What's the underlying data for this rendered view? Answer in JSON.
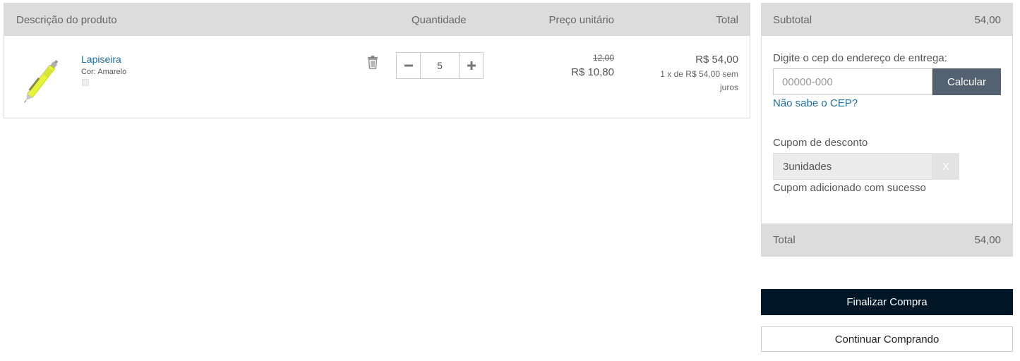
{
  "cart": {
    "headers": {
      "description": "Descrição do produto",
      "quantity": "Quantidade",
      "unit_price": "Preço unitário",
      "total": "Total"
    },
    "item": {
      "name": "Lapiseira",
      "variant": "Cor: Amarelo",
      "quantity": "5",
      "old_unit_price": "12,00",
      "unit_price": "R$ 10,80",
      "line_total": "R$ 54,00",
      "installments": "1 x de R$ 54,00 sem juros",
      "image_icon": "pencil-icon",
      "remove_icon": "trash-icon",
      "minus_icon": "minus-icon",
      "plus_icon": "plus-icon"
    }
  },
  "summary": {
    "subtotal_label": "Subtotal",
    "subtotal_value": "54,00",
    "cep_label": "Digite o cep do endereço de entrega:",
    "cep_placeholder": "00000-000",
    "cep_button": "Calcular",
    "cep_link": "Não sabe o CEP?",
    "coupon_label": "Cupom de desconto",
    "coupon_value": "3unidades",
    "coupon_clear": "X",
    "coupon_message": "Cupom adicionado com sucesso",
    "total_label": "Total",
    "total_value": "54,00"
  },
  "actions": {
    "finalize": "Finalizar Compra",
    "continue": "Continuar Comprando"
  },
  "colors": {
    "header_bg": "#dcdcdc",
    "link": "#1f6f9f",
    "calc_button": "#546170",
    "finalize_button": "#011627",
    "product_yellow": "#e6f53a"
  }
}
